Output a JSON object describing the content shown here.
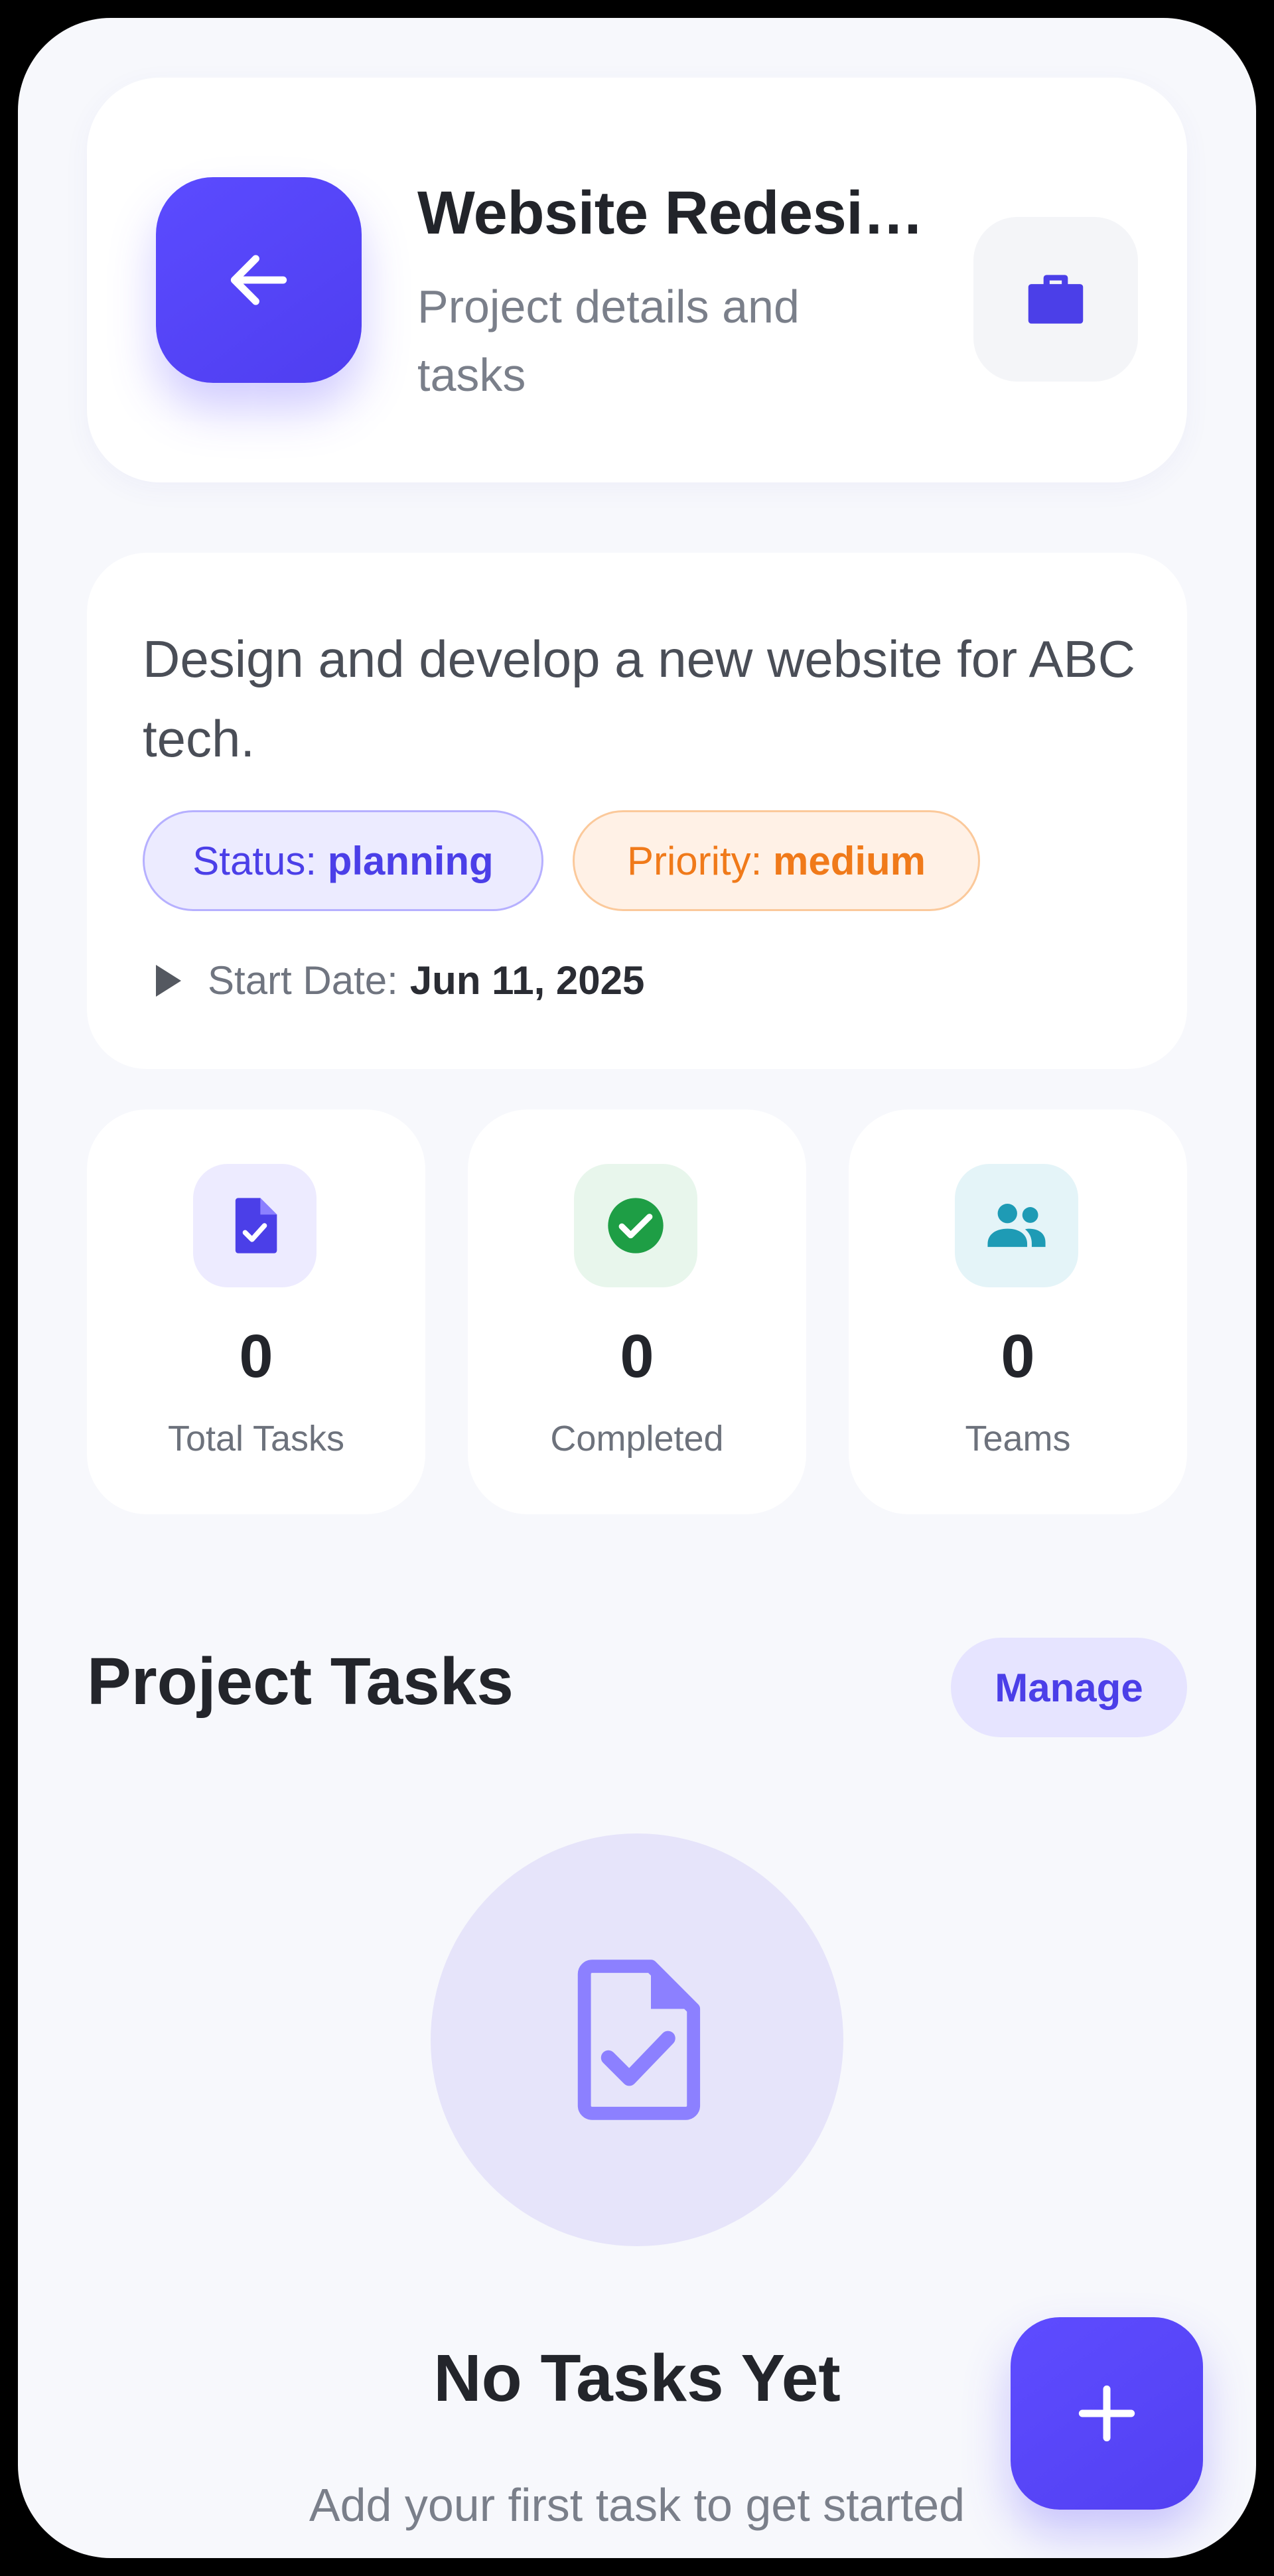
{
  "header": {
    "title": "Website Redesig…",
    "subtitle": "Project details and tasks",
    "back_icon": "arrow-left-icon",
    "project_icon": "briefcase-icon"
  },
  "project": {
    "description": "Design and develop a new website for ABC tech.",
    "status_label": "Status:",
    "status_value": "planning",
    "priority_label": "Priority:",
    "priority_value": "medium",
    "start_label": "Start Date:",
    "start_value": "Jun 11, 2025"
  },
  "stats": [
    {
      "value": "0",
      "label": "Total Tasks",
      "icon": "task-document-icon",
      "color": "#4B3FE8",
      "bg": "#EDEBFF"
    },
    {
      "value": "0",
      "label": "Completed",
      "icon": "check-circle-icon",
      "color": "#1E9E45",
      "bg": "#E8F6EC"
    },
    {
      "value": "0",
      "label": "Teams",
      "icon": "people-icon",
      "color": "#1E9BB5",
      "bg": "#E4F4F8"
    }
  ],
  "tasks_section": {
    "title": "Project Tasks",
    "manage_label": "Manage"
  },
  "empty_state": {
    "icon": "task-document-icon",
    "title": "No Tasks Yet",
    "subtitle": "Add your first task to get started"
  },
  "fab": {
    "icon": "plus-icon"
  },
  "colors": {
    "accent": "#5B4BFF",
    "background": "#F7F8FC",
    "card": "#FFFFFF"
  }
}
